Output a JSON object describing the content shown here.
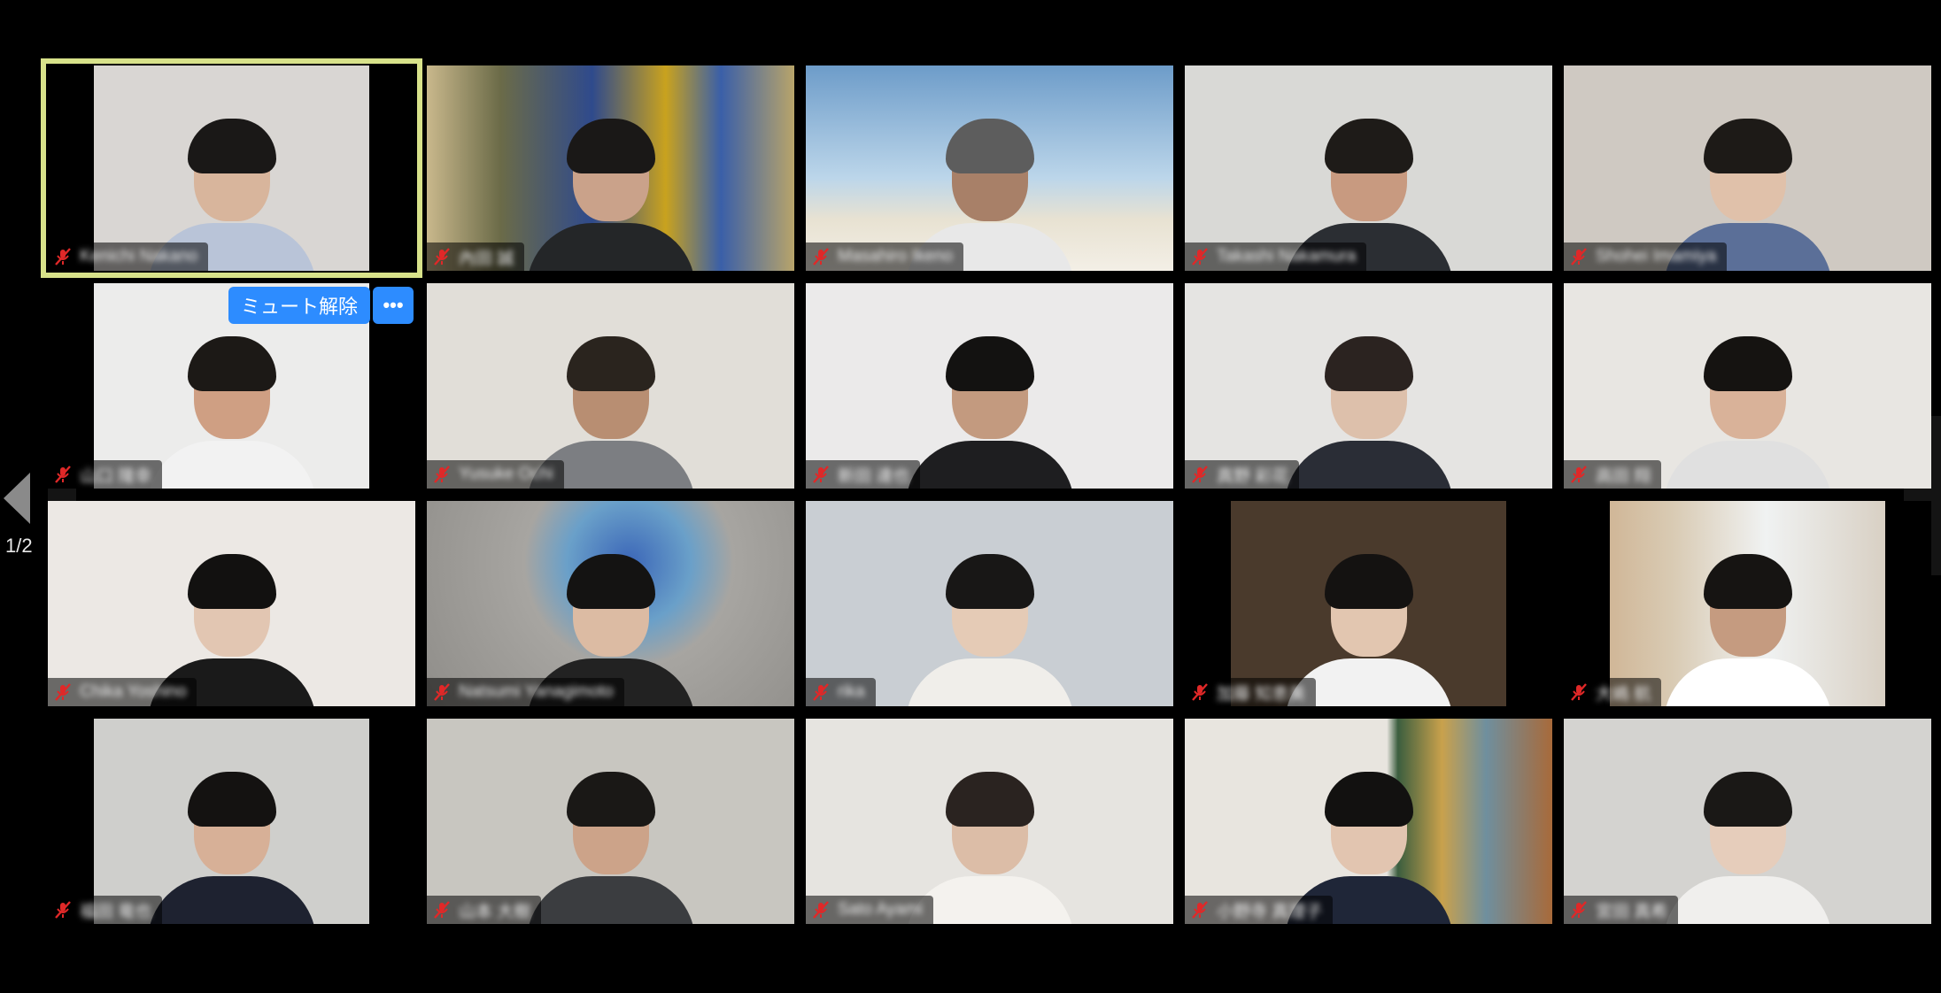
{
  "controls": {
    "unmute_label": "ミュート解除",
    "more_label": "•••",
    "page_indicator": "1/2",
    "prev_page_icon": "chevron-left-icon"
  },
  "colors": {
    "active_speaker_border": "#d8e28a",
    "accent_button": "#2d8cff",
    "mute_icon": "#e02828"
  },
  "participants": [
    {
      "name": "Kenichi Nakano",
      "active": true,
      "bg": "#d9d6d3",
      "shirt": "#b9c4d8",
      "hair": "#1a1817",
      "skin": "#d8b59c",
      "pillar": "both"
    },
    {
      "name": "內田 誠",
      "bg": "#7a6a4c",
      "shirt": "#242628",
      "hair": "#1a1817",
      "skin": "#caa28a",
      "pillar": "none",
      "scene": "detector"
    },
    {
      "name": "Masahiro Ikeno",
      "bg": "#a9c4dc",
      "shirt": "#e8e8e8",
      "hair": "#5d5d5d",
      "skin": "#a88068",
      "pillar": "none",
      "scene": "beach"
    },
    {
      "name": "Takashi Nakamura",
      "bg": "#d9d9d6",
      "shirt": "#2b2e33",
      "hair": "#1e1b18",
      "skin": "#c89a80",
      "pillar": "none"
    },
    {
      "name": "Shohei Imamiya",
      "bg": "#cfc9c2",
      "shirt": "#5b6f98",
      "hair": "#1d1a17",
      "skin": "#e0c1aa",
      "pillar": "none"
    },
    {
      "name": "山口 隆幸",
      "bg": "#ececeb",
      "shirt": "#f2f2f2",
      "hair": "#1c1916",
      "skin": "#cf9f83",
      "pillar": "both"
    },
    {
      "name": "Yusuke Ochi",
      "bg": "#e1ded8",
      "shirt": "#7c7e82",
      "hair": "#2a241e",
      "skin": "#b88e72",
      "pillar": "none"
    },
    {
      "name": "新田 達也",
      "bg": "#ebeaea",
      "shirt": "#1e1e20",
      "hair": "#131211",
      "skin": "#c39a7f",
      "pillar": "none"
    },
    {
      "name": "真野 彩花",
      "bg": "#e5e4e2",
      "shirt": "#2a2d36",
      "hair": "#2b2320",
      "skin": "#ddc0ab",
      "pillar": "none"
    },
    {
      "name": "高田 翔",
      "bg": "#e8e6e2",
      "shirt": "#e0e0e0",
      "hair": "#151311",
      "skin": "#d9b299",
      "pillar": "none"
    },
    {
      "name": "Chika Yoshino",
      "bg": "#ece8e4",
      "shirt": "#1a1a1a",
      "hair": "#121110",
      "skin": "#e2c6b2",
      "pillar": "none"
    },
    {
      "name": "Natsumi Yanagimoto",
      "bg": "#a9a7a3",
      "shirt": "#222",
      "hair": "#141312",
      "skin": "#dcbba3",
      "pillar": "none",
      "scene": "plate"
    },
    {
      "name": "rika",
      "bg": "#c9ced3",
      "shirt": "#f0eeea",
      "hair": "#181716",
      "skin": "#e5cbb6",
      "pillar": "none"
    },
    {
      "name": "加藤 知恵美",
      "bg": "#4a3a2c",
      "shirt": "#f2f2f2",
      "hair": "#141211",
      "skin": "#e2c6b0",
      "pillar": "both"
    },
    {
      "name": "大嶋 航",
      "bg": "#d6cbbc",
      "shirt": "#ffffff",
      "hair": "#161412",
      "skin": "#c59b80",
      "pillar": "both",
      "scene": "window"
    },
    {
      "name": "福田 竜也",
      "bg": "#cfcfcc",
      "shirt": "#1e2230",
      "hair": "#141211",
      "skin": "#d7b097",
      "pillar": "both"
    },
    {
      "name": "山本 大樹",
      "bg": "#c8c6c0",
      "shirt": "#3b3d40",
      "hair": "#1a1816",
      "skin": "#cca389",
      "pillar": "none"
    },
    {
      "name": "Sato Ayami",
      "bg": "#e6e4e0",
      "shirt": "#f4f2ee",
      "hair": "#2a2320",
      "skin": "#dcbda7",
      "pillar": "none"
    },
    {
      "name": "小野寺 真理子",
      "bg": "#dedbd5",
      "shirt": "#1f2638",
      "hair": "#121110",
      "skin": "#e2c5b0",
      "pillar": "none",
      "scene": "books"
    },
    {
      "name": "宮田 真希",
      "bg": "#d4d3d0",
      "shirt": "#f0efed",
      "hair": "#1a1816",
      "skin": "#e6cdbb",
      "pillar": "none"
    }
  ]
}
